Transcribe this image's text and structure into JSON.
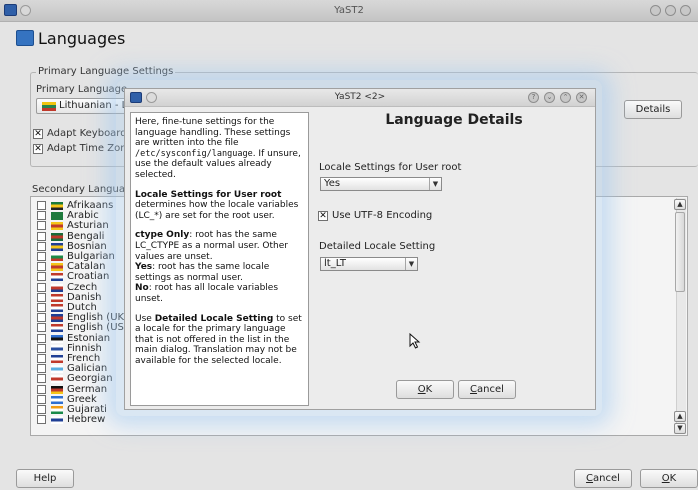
{
  "window": {
    "title": "YaST2"
  },
  "page": {
    "title": "Languages"
  },
  "primary": {
    "group_label": "Primary Language Settings",
    "language_label": "Primary Language",
    "language_value": "Lithuanian - Lie",
    "adapt_keyboard": "Adapt Keyboard L",
    "adapt_timezone": "Adapt Time Zone",
    "details_button": "Details"
  },
  "secondary": {
    "label": "Secondary Language",
    "items": [
      {
        "name": "Afrikaans"
      },
      {
        "name": "Arabic"
      },
      {
        "name": "Asturian"
      },
      {
        "name": "Bengali"
      },
      {
        "name": "Bosnian"
      },
      {
        "name": "Bulgarian"
      },
      {
        "name": "Catalan"
      },
      {
        "name": "Croatian"
      },
      {
        "name": "Czech"
      },
      {
        "name": "Danish"
      },
      {
        "name": "Dutch"
      },
      {
        "name": "English (UK)"
      },
      {
        "name": "English (US)"
      },
      {
        "name": "Estonian"
      },
      {
        "name": "Finnish"
      },
      {
        "name": "French"
      },
      {
        "name": "Galician"
      },
      {
        "name": "Georgian"
      },
      {
        "name": "German"
      },
      {
        "name": "Greek"
      },
      {
        "name": "Gujarati"
      },
      {
        "name": "Hebrew"
      }
    ]
  },
  "bottom": {
    "help": "Help",
    "cancel": "Cancel",
    "ok": "OK"
  },
  "dialog": {
    "title": "YaST2 <2>",
    "heading": "Language Details",
    "help": {
      "p1_a": "Here, fine-tune settings for the language handling. These settings are written into the file ",
      "p1_file": "/etc/sysconfig/language",
      "p1_b": ". If unsure, use the default values already selected.",
      "p2_title": "Locale Settings for User root",
      "p2_body": " determines how the locale variables (LC_*) are set for the root user.",
      "p3_ctype_t": "ctype Only",
      "p3_ctype_b": ": root has the same LC_CTYPE as a normal user. Other values are unset.",
      "p3_yes_t": "Yes",
      "p3_yes_b": ": root has the same locale settings as normal user.",
      "p3_no_t": "No",
      "p3_no_b": ": root has all locale variables unset.",
      "p4_a": "Use ",
      "p4_title": "Detailed Locale Setting",
      "p4_b": " to set a locale for the primary language that is not offered in the list in the main dialog. Translation may not be available for the selected locale."
    },
    "locale_root_label": "Locale Settings for User root",
    "locale_root_value": "Yes",
    "utf8_label": "Use UTF-8 Encoding",
    "detailed_label": "Detailed Locale Setting",
    "detailed_value": "lt_LT",
    "ok": "OK",
    "cancel": "Cancel"
  },
  "colors": {
    "accent": "#2f5fa8",
    "glow": "#a0c8f0"
  },
  "icons": {
    "app": "yast-icon",
    "page": "languages-icon",
    "check": "checkmark-icon",
    "dropdown": "chevron-down-icon",
    "scroll_up": "scroll-up-icon",
    "scroll_down": "scroll-down-icon",
    "cursor": "mouse-pointer-icon"
  }
}
